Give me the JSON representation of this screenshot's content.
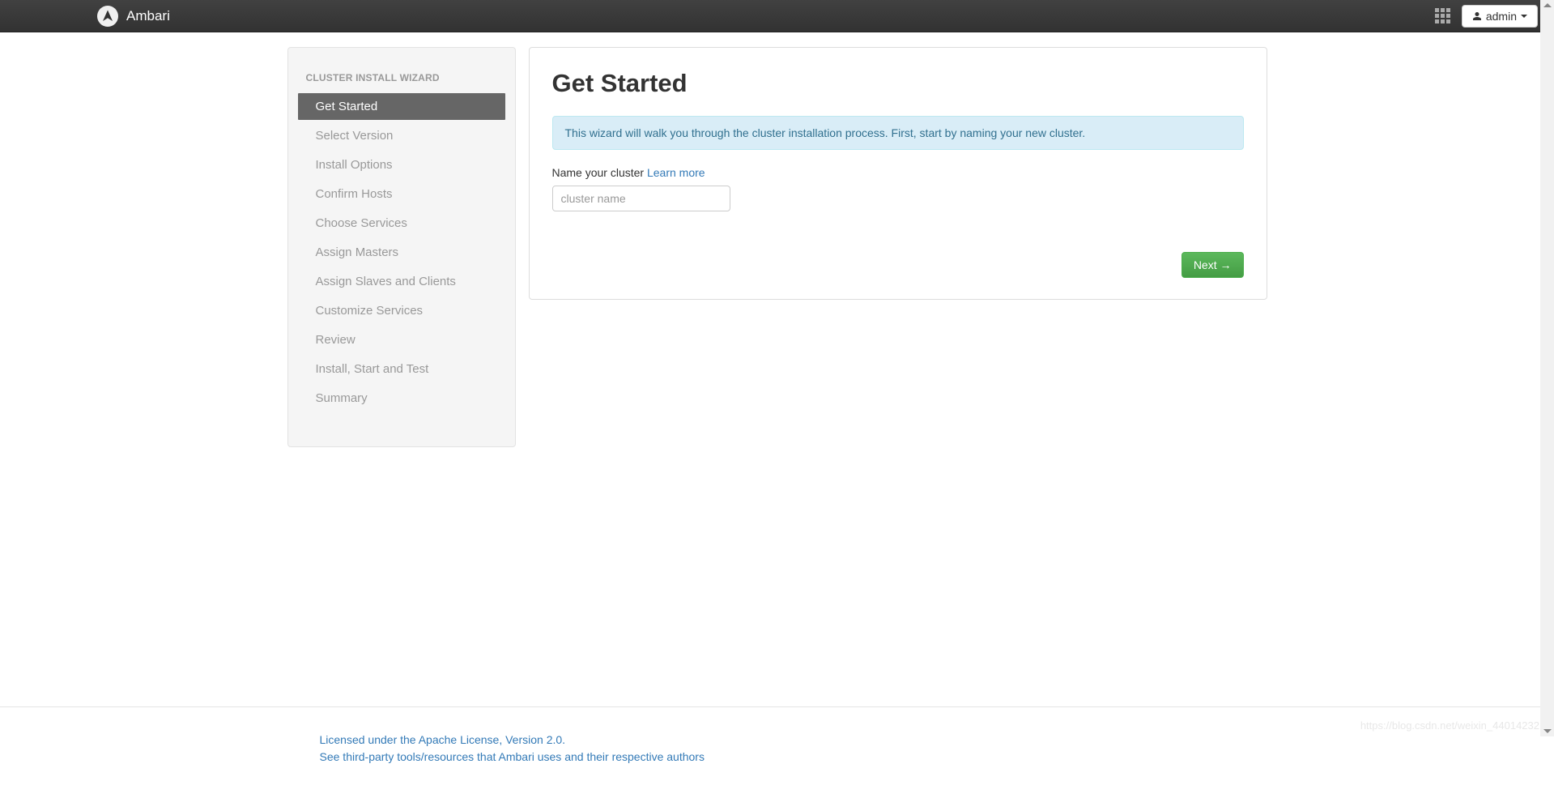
{
  "navbar": {
    "brand": "Ambari",
    "user_label": "admin"
  },
  "sidebar": {
    "title": "CLUSTER INSTALL WIZARD",
    "items": [
      {
        "label": "Get Started",
        "active": true
      },
      {
        "label": "Select Version",
        "active": false
      },
      {
        "label": "Install Options",
        "active": false
      },
      {
        "label": "Confirm Hosts",
        "active": false
      },
      {
        "label": "Choose Services",
        "active": false
      },
      {
        "label": "Assign Masters",
        "active": false
      },
      {
        "label": "Assign Slaves and Clients",
        "active": false
      },
      {
        "label": "Customize Services",
        "active": false
      },
      {
        "label": "Review",
        "active": false
      },
      {
        "label": "Install, Start and Test",
        "active": false
      },
      {
        "label": "Summary",
        "active": false
      }
    ]
  },
  "main": {
    "heading": "Get Started",
    "intro": "This wizard will walk you through the cluster installation process. First, start by naming your new cluster.",
    "field_label": "Name your cluster",
    "learn_more": "Learn more",
    "placeholder": "cluster name",
    "cluster_name_value": "",
    "next_button": "Next →"
  },
  "footer": {
    "license_link": "Licensed under the Apache License, Version 2.0.",
    "thirdparty_link": "See third-party tools/resources that Ambari uses and their respective authors"
  },
  "watermark": "https://blog.csdn.net/weixin_44014232"
}
